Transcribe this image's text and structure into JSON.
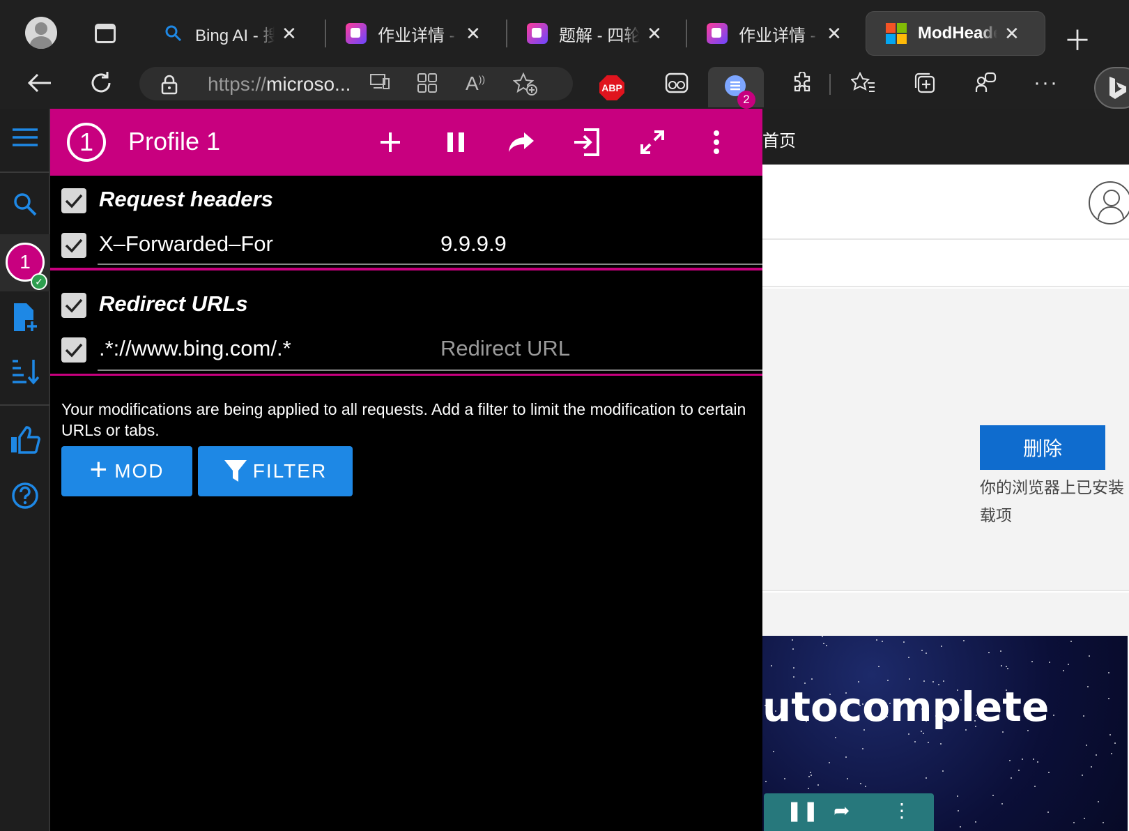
{
  "tabs": [
    {
      "title": "Bing AI - 搜索",
      "favicon": "search-icon"
    },
    {
      "title": "作业详情 - 四川",
      "favicon": "app-icon"
    },
    {
      "title": "题解 - 四轮",
      "favicon": "app-icon"
    },
    {
      "title": "作业详情 - 四川",
      "favicon": "app-icon"
    },
    {
      "title": "ModHeader",
      "favicon": "microsoft-logo",
      "active": true
    }
  ],
  "toolbar": {
    "url_scheme": "https://",
    "url_host": "microso...",
    "abp_label": "ABP",
    "modheader_badge": "2"
  },
  "page": {
    "nav_home": "首页",
    "delete_button": "删除",
    "message": "你的浏览器上已安装",
    "message2": "载项",
    "hero_title": "utocomplete"
  },
  "modheader": {
    "profile_number": "1",
    "profile_name": "Profile 1",
    "request_headers_title": "Request headers",
    "header_rows": [
      {
        "name": "X–Forwarded–For",
        "value": "9.9.9.9"
      }
    ],
    "redirect_title": "Redirect URLs",
    "redirect_rows": [
      {
        "pattern": ".*://www.bing.com/.*",
        "placeholder": "Redirect URL"
      }
    ],
    "note": "Your modifications are being applied to all requests. Add a filter to limit the modification to certain URLs or tabs.",
    "add_mod_label": "MOD",
    "filter_label": "FILTER"
  },
  "rail": {
    "profile_number": "1"
  },
  "colors": {
    "accent": "#c8007f",
    "button_blue": "#1e88e5",
    "page_blue": "#0f6cce"
  }
}
